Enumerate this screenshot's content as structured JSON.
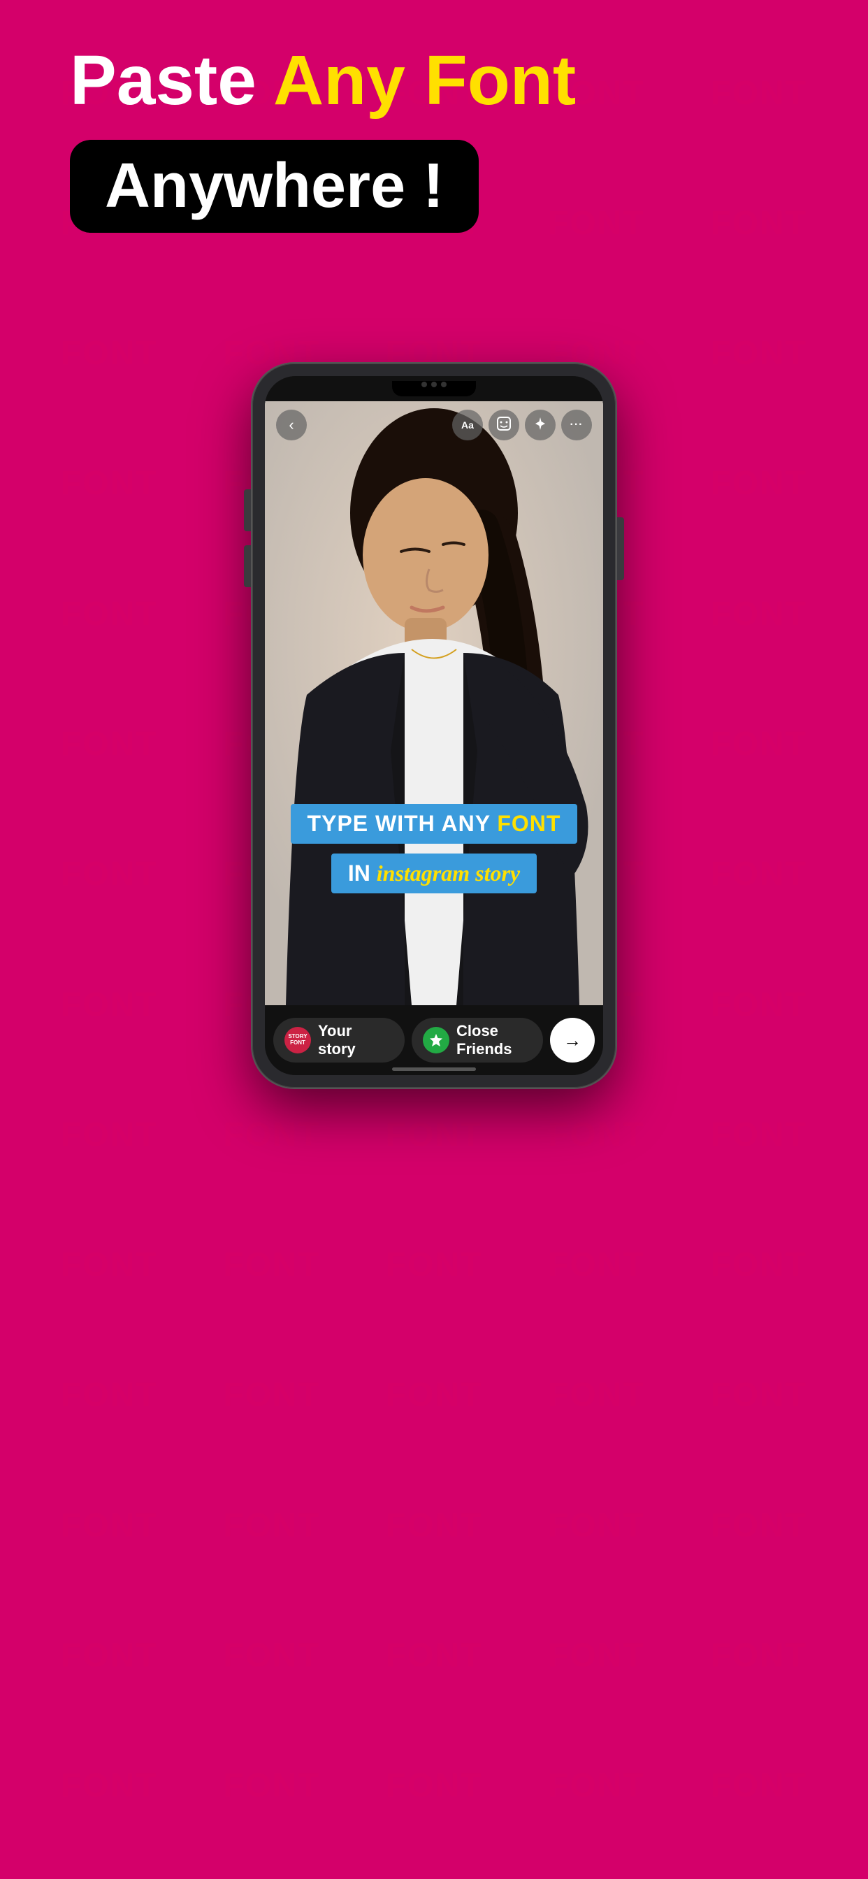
{
  "background": {
    "color": "#D4006A",
    "watermark_word": "FONT"
  },
  "header": {
    "line1_white": "Paste",
    "line1_yellow": "Any Font",
    "anywhere_box": "Anywhere !"
  },
  "phone": {
    "toolbar": {
      "back_icon": "‹",
      "text_icon": "Aa",
      "sticker_icon": "☺",
      "effects_icon": "✦",
      "more_icon": "···"
    },
    "story_text": {
      "line1_regular": "TYPE WITH ANY",
      "line1_highlight": "FONT",
      "line2_in": "IN",
      "line2_instagram": "instagram story"
    },
    "bottom_bar": {
      "your_story_label": "Your story",
      "close_friends_label": "Close Friends",
      "story_font_icon_text": "STORY\nFONT",
      "arrow_icon": "→"
    },
    "home_bar": {
      "left_icon": "⌐",
      "center_icon": "□",
      "right_icon": "↵"
    }
  },
  "watermark_items": [
    "FONT",
    "FONT",
    "FONT",
    "FONT",
    "FONT",
    "FONT",
    "FONT",
    "FONT",
    "FONT",
    "FONT",
    "FONT",
    "FONT",
    "FONT",
    "FONT",
    "FONT",
    "FONT",
    "FONT",
    "FONT",
    "FONT",
    "FONT",
    "FONT",
    "FONT",
    "FONT",
    "FONT",
    "FONT",
    "FONT",
    "FONT",
    "FONT",
    "FONT",
    "FONT",
    "FONT",
    "FONT",
    "FONT",
    "FONT",
    "FONT",
    "FONT",
    "FONT",
    "FONT",
    "FONT",
    "FONT",
    "FONT",
    "FONT",
    "FONT",
    "FONT",
    "FONT",
    "FONT",
    "FONT",
    "FONT",
    "FONT",
    "FONT",
    "FONT",
    "FONT",
    "FONT",
    "FONT",
    "FONT",
    "FONT",
    "FONT",
    "FONT",
    "FONT",
    "FONT",
    "FONT",
    "FONT",
    "FONT",
    "FONT",
    "FONT",
    "FONT",
    "FONT",
    "FONT",
    "FONT",
    "FONT"
  ]
}
